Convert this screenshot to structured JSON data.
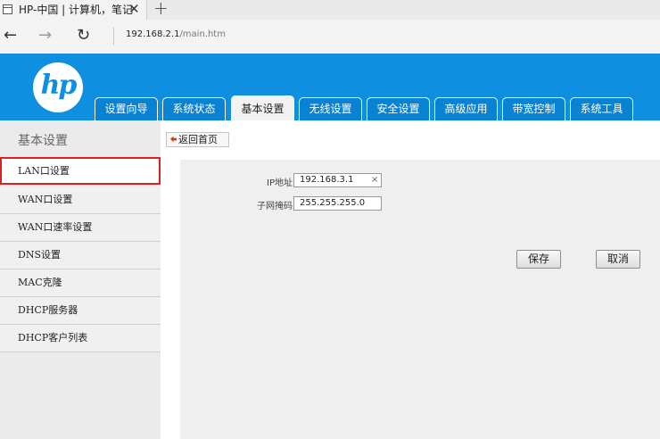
{
  "browser": {
    "tab_title": "HP-中国 | 计算机，笔记",
    "tab_close": "✕",
    "new_tab": "+",
    "url_host": "192.168.2.1",
    "url_path": "/main.htm",
    "back_glyph": "←",
    "forward_glyph": "→",
    "refresh_glyph": "↻"
  },
  "header": {
    "logo_text": "hp",
    "brand_color": "#0e8fe0",
    "tabs": [
      {
        "label": "设置向导"
      },
      {
        "label": "系统状态"
      },
      {
        "label": "基本设置",
        "active": true
      },
      {
        "label": "无线设置"
      },
      {
        "label": "安全设置"
      },
      {
        "label": "高级应用"
      },
      {
        "label": "带宽控制"
      },
      {
        "label": "系统工具"
      }
    ]
  },
  "sidebar": {
    "title": "基本设置",
    "items": [
      {
        "label": "LAN口设置",
        "active": true
      },
      {
        "label": "WAN口设置"
      },
      {
        "label": "WAN口速率设置"
      },
      {
        "label": "DNS设置"
      },
      {
        "label": "MAC克隆"
      },
      {
        "label": "DHCP服务器"
      },
      {
        "label": "DHCP客户列表"
      }
    ]
  },
  "content": {
    "back_home_label": "返回首页",
    "ip_label": "IP地址",
    "ip_value": "192.168.3.1",
    "ip_clear": "×",
    "mask_label": "子网掩码",
    "mask_value": "255.255.255.0",
    "save_label": "保存",
    "cancel_label": "取消"
  }
}
